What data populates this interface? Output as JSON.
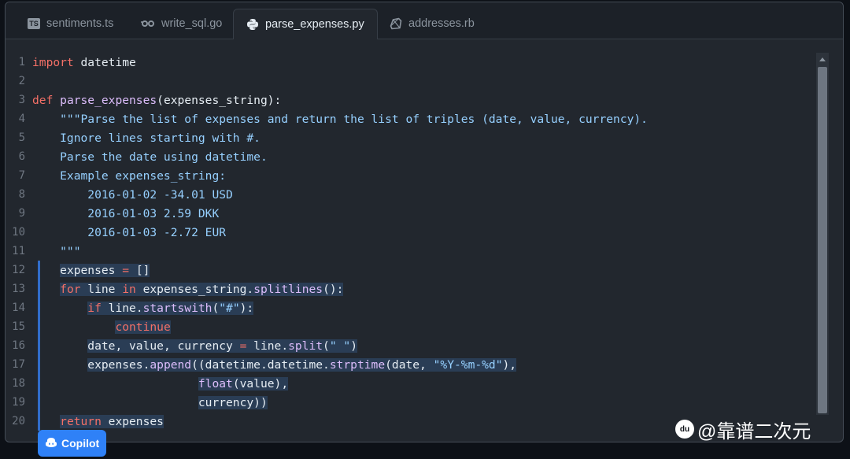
{
  "tabs": [
    {
      "label": "sentiments.ts",
      "icon": "typescript-icon",
      "icon_text": "TS"
    },
    {
      "label": "write_sql.go",
      "icon": "go-icon"
    },
    {
      "label": "parse_expenses.py",
      "icon": "python-icon"
    },
    {
      "label": "addresses.rb",
      "icon": "ruby-icon"
    }
  ],
  "active_tab": "parse_expenses.py",
  "code": {
    "line_numbers": [
      "1",
      "2",
      "3",
      "4",
      "5",
      "6",
      "7",
      "8",
      "9",
      "10",
      "11",
      "12",
      "13",
      "14",
      "15",
      "16",
      "17",
      "18",
      "19",
      "20"
    ],
    "highlighted_lines": [
      12,
      13,
      14,
      15,
      16,
      17,
      18,
      19,
      20
    ]
  },
  "copilot": {
    "label": "Copilot"
  },
  "watermark": {
    "text": "@靠谱二次元",
    "logo_text": "du"
  },
  "colors": {
    "background": "#22272e",
    "keyword": "#f47067",
    "function": "#dcbdfb",
    "string": "#96d0ff",
    "selection": "#2a3d55",
    "accent": "#2f81f7"
  }
}
